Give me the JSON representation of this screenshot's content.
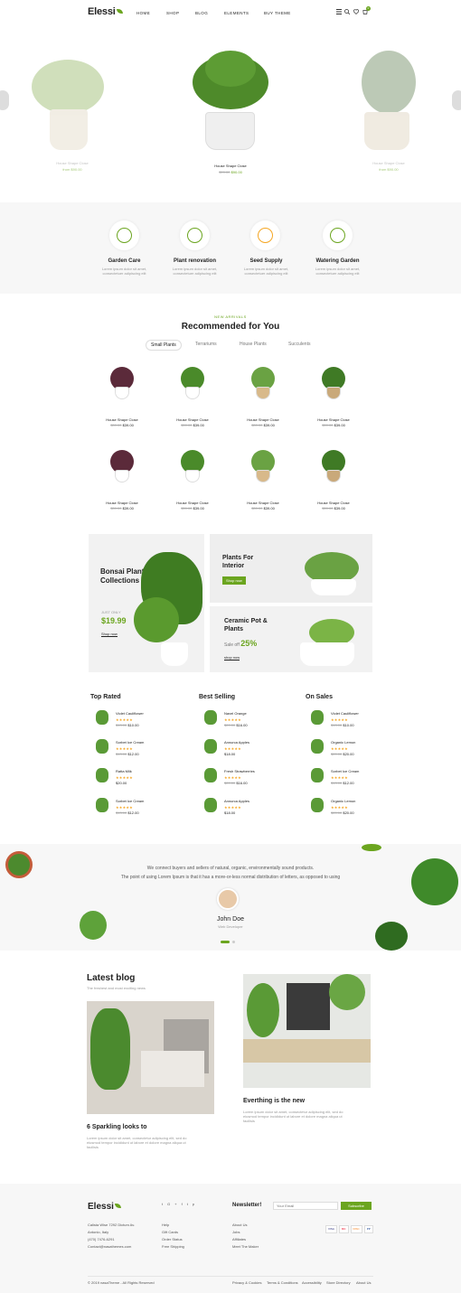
{
  "brand": {
    "name": "Elessi",
    "accent": "#6ba51f"
  },
  "nav": {
    "items": [
      "HOME",
      "SHOP",
      "BLOG",
      "ELEMENTS",
      "BUY THEME"
    ],
    "cart_count": "0"
  },
  "hero": {
    "left": {
      "name": "House Shape Close",
      "price": "from $90.00"
    },
    "center": {
      "name": "House Shape Close",
      "old_price": "$99.00",
      "price": "$90.00"
    },
    "right": {
      "name": "House Shape Close",
      "price": "from $90.00"
    }
  },
  "features": [
    {
      "title": "Garden Care",
      "text": "Lorem ipsum dolor sit amet, consectetuer adipiscing elit"
    },
    {
      "title": "Plant renovation",
      "text": "Lorem ipsum dolor sit amet, consectetuer adipiscing elit"
    },
    {
      "title": "Seed Supply",
      "text": "Lorem ipsum dolor sit amet, consectetuer adipiscing elit"
    },
    {
      "title": "Watering Garden",
      "text": "Lorem ipsum dolor sit amet, consectetuer adipiscing elit"
    }
  ],
  "recommended": {
    "eyebrow": "NEW ARRIVALS",
    "title": "Recommended for You",
    "tabs": [
      "Small Plants",
      "Terrariums",
      "House Plants",
      "Succulents"
    ],
    "products": [
      {
        "name": "House Shape Close",
        "old": "$39.00",
        "price": "$39.00"
      },
      {
        "name": "House Shape Close",
        "old": "$39.00",
        "price": "$39.00"
      },
      {
        "name": "House Shape Close",
        "old": "$39.00",
        "price": "$39.00"
      },
      {
        "name": "House Shape Close",
        "old": "$39.00",
        "price": "$39.00"
      },
      {
        "name": "House Shape Close",
        "old": "$39.00",
        "price": "$39.00"
      },
      {
        "name": "House Shape Close",
        "old": "$39.00",
        "price": "$39.00"
      },
      {
        "name": "House Shape Close",
        "old": "$39.00",
        "price": "$39.00"
      },
      {
        "name": "House Shape Close",
        "old": "$39.00",
        "price": "$39.00"
      }
    ]
  },
  "promos": {
    "bonsai": {
      "title": "Bonsai Plants Collections",
      "label": "JUST ONLY",
      "price": "$19.99",
      "cta": "Shop now"
    },
    "interior": {
      "title": "Plants For Interior",
      "cta": "Shop now"
    },
    "ceramic": {
      "title": "Ceramic Pot & Plants",
      "sale_label": "Sale off",
      "sale_value": "25%",
      "cta": "shop now"
    }
  },
  "lists": {
    "top_rated": {
      "title": "Top Rated",
      "items": [
        {
          "name": "Violet Cauliflower",
          "old": "$13.00",
          "price": "$10.00"
        },
        {
          "name": "Sorbet Ice Cream",
          "old": "$13.00",
          "price": "$12.00"
        },
        {
          "name": "Ratta Milk",
          "old": "",
          "price": "$20.00"
        },
        {
          "name": "Sorbet Ice Cream",
          "old": "$13.00",
          "price": "$12.00"
        }
      ]
    },
    "best_selling": {
      "title": "Best Selling",
      "items": [
        {
          "name": "Navel Orange",
          "old": "$20.00",
          "price": "$16.00"
        },
        {
          "name": "Annurca Apples",
          "old": "",
          "price": "$18.00"
        },
        {
          "name": "Fresh Strawberries",
          "old": "$20.00",
          "price": "$16.00"
        },
        {
          "name": "Annurca Apples",
          "old": "",
          "price": "$18.00"
        }
      ]
    },
    "on_sales": {
      "title": "On Sales",
      "items": [
        {
          "name": "Violet Cauliflower",
          "old": "$13.00",
          "price": "$10.00"
        },
        {
          "name": "Organic Lemon",
          "old": "$20.00",
          "price": "$20.00"
        },
        {
          "name": "Sorbet Ice Cream",
          "old": "$13.00",
          "price": "$12.00"
        },
        {
          "name": "Organic Lemon",
          "old": "$20.00",
          "price": "$20.00"
        }
      ]
    }
  },
  "testimonial": {
    "line1": "We connect buyers and sellers of natural, organic, environmentally sound products.",
    "line2": "The point of using Lorem Ipsum is that it has a more-or-less normal distribution of letters, as opposed to using",
    "name": "John Doe",
    "role": "Web Developer"
  },
  "blog": {
    "title": "Latest blog",
    "subtitle": "The freshest and most exciting news",
    "posts": [
      {
        "title": "6 Sparkling looks to",
        "excerpt": "Lorem ipsum dolor sit amet, consectetur adipiscing elit, sed do eiusmod tempor incididunt ut labore et dolore magna aliqua ut facilisis"
      },
      {
        "title": "Everthing is the new",
        "excerpt": "Lorem ipsum dolor sit amet, consectetur adipiscing elit, sed do eiusmod tempor incididunt ut labore et dolore magna aliqua ut facilisis"
      }
    ]
  },
  "footer": {
    "address": [
      "Calista Wise 7292 Dictum Av.",
      "Antonio, Italy",
      "(470) 7476-6291",
      "Contact@nasathemes.com"
    ],
    "col2": [
      "Help",
      "Gift Cards",
      "Order Status",
      "Free Shipping"
    ],
    "col3": [
      "About Us",
      "Jobs",
      "Affiliates",
      "Meet The Maker"
    ],
    "newsletter_title": "Newsletter!",
    "newsletter_placeholder": "Your Email",
    "subscribe": "Subscribe",
    "copyright": "© 2019 nasaTheme - All Rights Reserved",
    "bottom_links": [
      "Privacy & Cookies",
      "Terms & Conditions",
      "Accessibility",
      "Store Directory",
      "About Us"
    ],
    "social": [
      "t",
      "G+",
      "f",
      "t",
      "p"
    ],
    "payments": [
      "VISA",
      "MC",
      "DISC",
      "PP"
    ]
  }
}
